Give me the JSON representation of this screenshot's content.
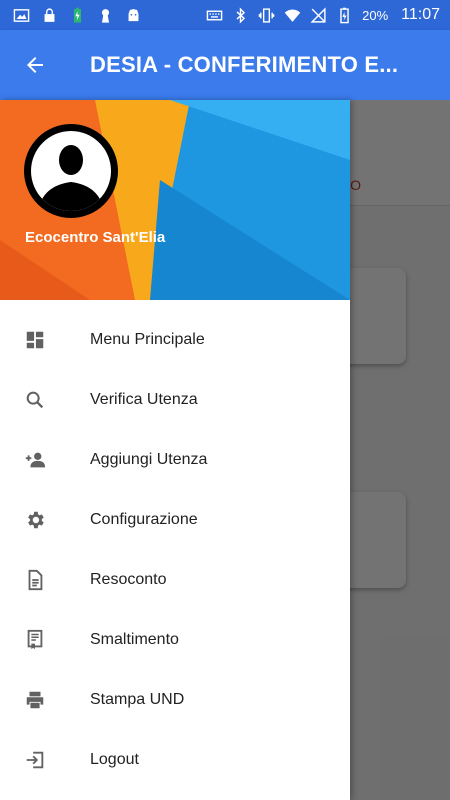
{
  "status_bar": {
    "battery_percent": "20%",
    "time": "11:07",
    "icons_left": [
      "image-icon",
      "lock-icon",
      "battery-charging-icon",
      "keyhole-icon",
      "android-icon"
    ],
    "icons_right": [
      "keyboard-icon",
      "bluetooth-icon",
      "vibrate-icon",
      "wifi-icon",
      "no-signal-icon",
      "battery-icon"
    ]
  },
  "app_bar": {
    "title": "DESIA - CONFERIMENTO E...",
    "back_icon": "arrow-back-icon",
    "color": "#3b7bec"
  },
  "background_screen": {
    "tab_label_fragment": "RO"
  },
  "drawer": {
    "user_name": "Ecocentro Sant'Elia",
    "items": [
      {
        "label": "Menu Principale",
        "icon": "dashboard-icon"
      },
      {
        "label": "Verifica Utenza",
        "icon": "search-icon"
      },
      {
        "label": "Aggiungi Utenza",
        "icon": "person-add-icon"
      },
      {
        "label": "Configurazione",
        "icon": "gear-icon"
      },
      {
        "label": "Resoconto",
        "icon": "document-icon"
      },
      {
        "label": "Smaltimento",
        "icon": "certificate-icon"
      },
      {
        "label": "Stampa UND",
        "icon": "printer-icon"
      },
      {
        "label": "Logout",
        "icon": "logout-icon"
      }
    ]
  },
  "colors": {
    "status_bar": "#2e67d6",
    "accent_blue": "#3b7bec",
    "header_orange": "#f26b21",
    "header_blue": "#1f96e0",
    "icon_gray": "#616161"
  }
}
